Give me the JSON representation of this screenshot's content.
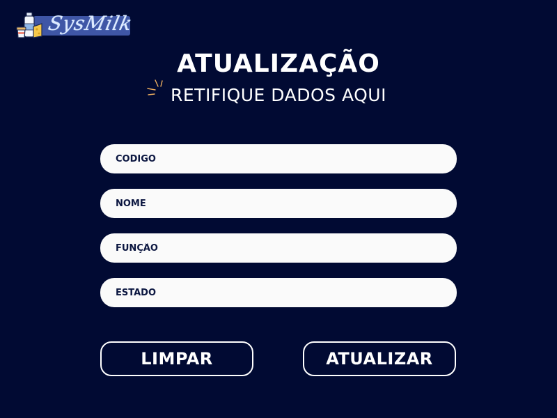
{
  "brand": {
    "logo_text": "SysMilk",
    "logo_icon": "dairy-products-icon"
  },
  "header": {
    "title": "ATUALIZAÇÃO",
    "subtitle": "RETIFIQUE DADOS AQUI",
    "decoration_icon": "sparkle-icon"
  },
  "form": {
    "fields": [
      {
        "placeholder": "CÓDIGO",
        "value": ""
      },
      {
        "placeholder": "NOME",
        "value": ""
      },
      {
        "placeholder": "FUNÇÃO",
        "value": ""
      },
      {
        "placeholder": "ESTADO",
        "value": ""
      }
    ]
  },
  "actions": {
    "clear_label": "LIMPAR",
    "update_label": "ATUALIZAR"
  },
  "colors": {
    "background": "#010a33",
    "field_background": "#fafafa",
    "field_text": "#0b1640",
    "logo_band": "#3f56a6",
    "text": "#ffffff"
  }
}
